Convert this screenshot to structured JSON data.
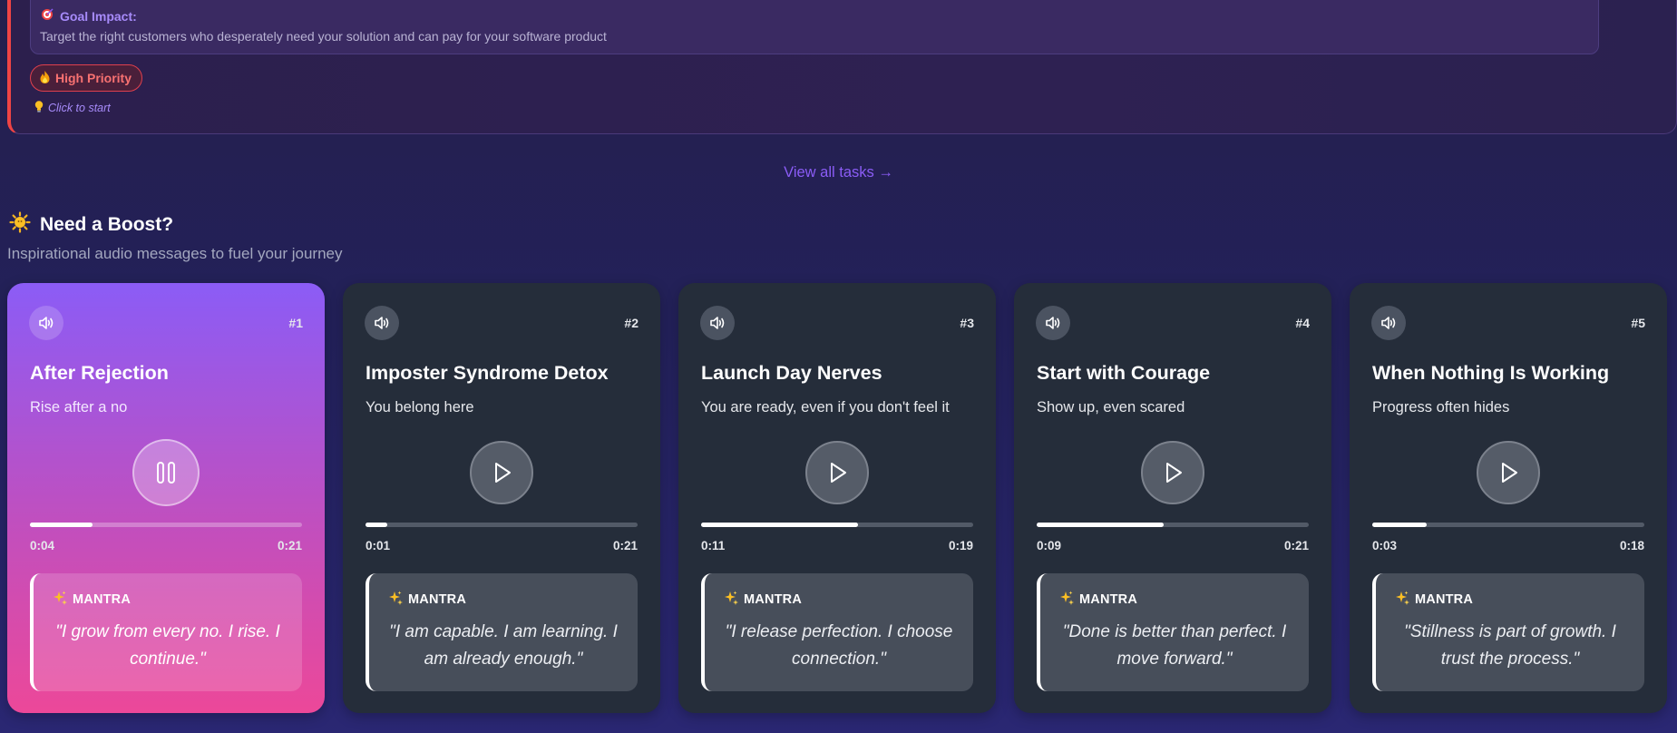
{
  "task": {
    "goal_icon": "target-icon",
    "goal_label": "Goal Impact:",
    "goal_text": "Target the right customers who desperately need your solution and can pay for your software product",
    "priority_icon": "fire-icon",
    "priority_label": "High Priority",
    "hint_icon": "lightbulb-icon",
    "hint_text": "Click to start",
    "accent_color": "#ef4444"
  },
  "view_all_label": "View all tasks →",
  "boost": {
    "icon": "sun-icon",
    "title": "Need a Boost?",
    "subtitle": "Inspirational audio messages to fuel your journey"
  },
  "cards": [
    {
      "num": "#1",
      "title": "After Rejection",
      "subtitle": "Rise after a no",
      "state": "playing",
      "current": "0:04",
      "total": "0:21",
      "progress": 0.23,
      "mantra_label": "MANTRA",
      "quote": "\"I grow from every no. I rise. I continue.\""
    },
    {
      "num": "#2",
      "title": "Imposter Syndrome Detox",
      "subtitle": "You belong here",
      "state": "paused",
      "current": "0:01",
      "total": "0:21",
      "progress": 0.08,
      "mantra_label": "MANTRA",
      "quote": "\"I am capable. I am learning. I am already enough.\""
    },
    {
      "num": "#3",
      "title": "Launch Day Nerves",
      "subtitle": "You are ready, even if you don't feel it",
      "state": "paused",
      "current": "0:11",
      "total": "0:19",
      "progress": 0.575,
      "mantra_label": "MANTRA",
      "quote": "\"I release perfection. I choose connection.\""
    },
    {
      "num": "#4",
      "title": "Start with Courage",
      "subtitle": "Show up, even scared",
      "state": "paused",
      "current": "0:09",
      "total": "0:21",
      "progress": 0.465,
      "mantra_label": "MANTRA",
      "quote": "\"Done is better than perfect. I move forward.\""
    },
    {
      "num": "#5",
      "title": "When Nothing Is Working",
      "subtitle": "Progress often hides",
      "state": "paused",
      "current": "0:03",
      "total": "0:18",
      "progress": 0.2,
      "mantra_label": "MANTRA",
      "quote": "\"Stillness is part of growth. I trust the process.\""
    }
  ],
  "colors": {
    "active_gradient_top": "#8b5cf6",
    "active_gradient_bottom": "#ec4899",
    "card_bg": "#252d3a",
    "link": "#8b5cf6"
  }
}
